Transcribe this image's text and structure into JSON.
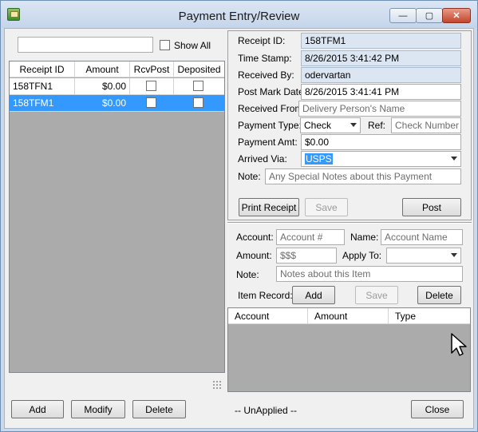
{
  "window": {
    "title": "Payment Entry/Review",
    "controls": {
      "minimize": "—",
      "maximize": "▢",
      "close": "✕"
    }
  },
  "left": {
    "search": {
      "value": "",
      "placeholder": ""
    },
    "show_all_label": "Show All",
    "show_all_checked": false,
    "columns": [
      "Receipt ID",
      "Amount",
      "RcvPost",
      "Deposited"
    ],
    "rows": [
      {
        "receipt_id": "158TFN1",
        "amount": "$0.00",
        "rcvpost": false,
        "deposited": false,
        "selected": false
      },
      {
        "receipt_id": "158TFM1",
        "amount": "$0.00",
        "rcvpost": false,
        "deposited": false,
        "selected": true
      }
    ]
  },
  "receipt": {
    "receipt_id_label": "Receipt ID:",
    "receipt_id": "158TFM1",
    "timestamp_label": "Time Stamp:",
    "timestamp": "8/26/2015 3:41:42 PM",
    "received_by_label": "Received By:",
    "received_by": "odervartan",
    "post_mark_label": "Post Mark Date:",
    "post_mark": "8/26/2015 3:41:41 PM",
    "received_from_label": "Received From:",
    "received_from_placeholder": "Delivery Person's Name",
    "payment_type_label": "Payment Type:",
    "payment_type": "Check",
    "ref_label": "Ref:",
    "ref_placeholder": "Check Number",
    "payment_amt_label": "Payment Amt:",
    "payment_amt": "$0.00",
    "arrived_via_label": "Arrived Via:",
    "arrived_via": "USPS",
    "note_label": "Note:",
    "note_placeholder": "Any Special Notes about this Payment",
    "print_receipt": "Print Receipt",
    "save": "Save",
    "post": "Post"
  },
  "item": {
    "account_label": "Account:",
    "account_placeholder": "Account #",
    "name_label": "Name:",
    "name_placeholder": "Account Name",
    "amount_label": "Amount:",
    "amount_placeholder": "$$$",
    "apply_to_label": "Apply To:",
    "apply_to": "",
    "note_label": "Note:",
    "note_placeholder": "Notes about this Item",
    "item_record_label": "Item Record:",
    "add": "Add",
    "save": "Save",
    "delete": "Delete",
    "columns": [
      "Account",
      "Amount",
      "Type"
    ]
  },
  "footer": {
    "add": "Add",
    "modify": "Modify",
    "delete": "Delete",
    "status": "-- UnApplied --",
    "close": "Close"
  },
  "colors": {
    "selection": "#3399ff",
    "readonly_field": "#dce6f2",
    "grid_background": "#ababab"
  }
}
